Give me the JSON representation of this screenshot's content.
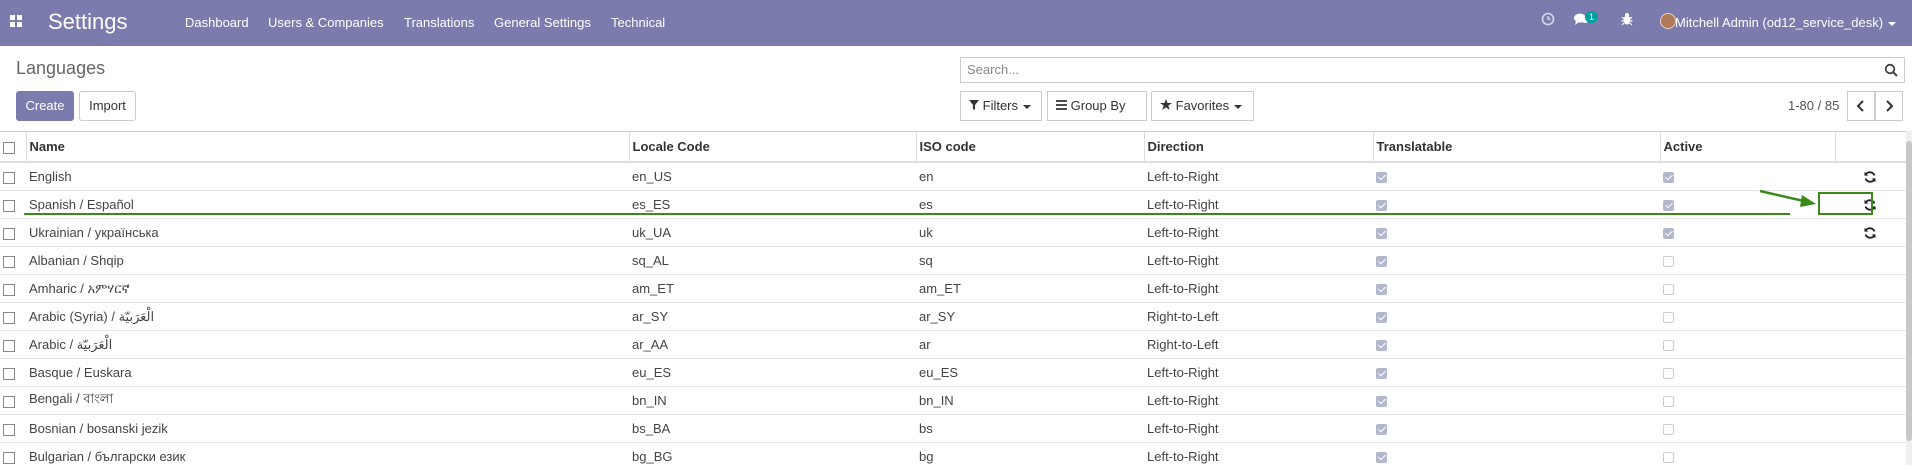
{
  "navbar": {
    "app_title": "Settings",
    "menu": [
      "Dashboard",
      "Users & Companies",
      "Translations",
      "General Settings",
      "Technical"
    ],
    "messages_badge": "1",
    "user": "Mitchell Admin (od12_service_desk)",
    "icons": [
      "apps-grid-icon",
      "clock-icon",
      "chat-icon",
      "bug-icon"
    ]
  },
  "page": {
    "title": "Languages",
    "create_label": "Create",
    "import_label": "Import",
    "search_placeholder": "Search...",
    "filters_label": "Filters",
    "groupby_label": "Group By",
    "favorites_label": "Favorites",
    "pager": "1-80 / 85"
  },
  "table": {
    "columns": [
      "Name",
      "Locale Code",
      "ISO code",
      "Direction",
      "Translatable",
      "Active"
    ],
    "rows": [
      {
        "name": "English",
        "locale": "en_US",
        "iso": "en",
        "direction": "Left-to-Right",
        "translatable": true,
        "active": true,
        "update": true
      },
      {
        "name": "Spanish / Español",
        "locale": "es_ES",
        "iso": "es",
        "direction": "Left-to-Right",
        "translatable": true,
        "active": true,
        "update": true
      },
      {
        "name": "Ukrainian / українська",
        "locale": "uk_UA",
        "iso": "uk",
        "direction": "Left-to-Right",
        "translatable": true,
        "active": true,
        "update": true
      },
      {
        "name": "Albanian / Shqip",
        "locale": "sq_AL",
        "iso": "sq",
        "direction": "Left-to-Right",
        "translatable": true,
        "active": false,
        "update": false
      },
      {
        "name": "Amharic / አምሃርኛ",
        "locale": "am_ET",
        "iso": "am_ET",
        "direction": "Left-to-Right",
        "translatable": true,
        "active": false,
        "update": false
      },
      {
        "name": "Arabic (Syria) / الْعَرَبيّة",
        "locale": "ar_SY",
        "iso": "ar_SY",
        "direction": "Right-to-Left",
        "translatable": true,
        "active": false,
        "update": false
      },
      {
        "name": "Arabic / الْعَرَبيّة",
        "locale": "ar_AA",
        "iso": "ar",
        "direction": "Right-to-Left",
        "translatable": true,
        "active": false,
        "update": false
      },
      {
        "name": "Basque / Euskara",
        "locale": "eu_ES",
        "iso": "eu_ES",
        "direction": "Left-to-Right",
        "translatable": true,
        "active": false,
        "update": false
      },
      {
        "name": "Bengali / বাংলা",
        "locale": "bn_IN",
        "iso": "bn_IN",
        "direction": "Left-to-Right",
        "translatable": true,
        "active": false,
        "update": false
      },
      {
        "name": "Bosnian / bosanski jezik",
        "locale": "bs_BA",
        "iso": "bs",
        "direction": "Left-to-Right",
        "translatable": true,
        "active": false,
        "update": false
      },
      {
        "name": "Bulgarian / български език",
        "locale": "bg_BG",
        "iso": "bg",
        "direction": "Left-to-Right",
        "translatable": true,
        "active": false,
        "update": false
      }
    ]
  },
  "annotation": {
    "color": "#3a8a1a",
    "target": "Spanish / Español update button"
  },
  "colors": {
    "navbar": "#7c7bad",
    "primary_button": "#7c7bad"
  }
}
